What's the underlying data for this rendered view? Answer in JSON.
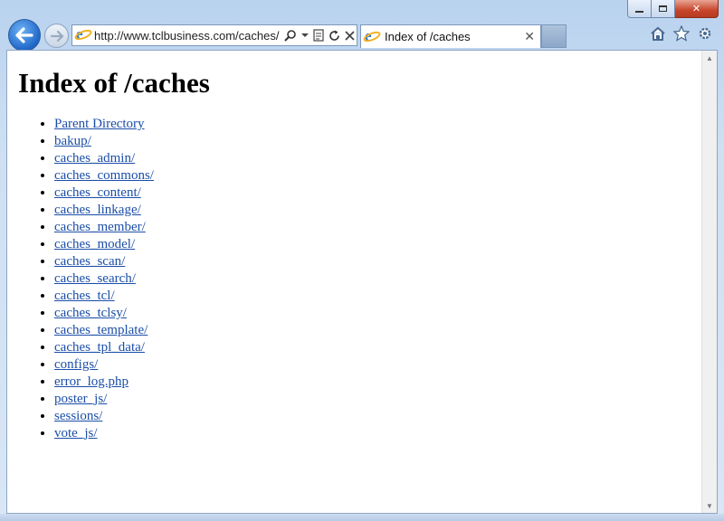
{
  "browser": {
    "address_url": "http://www.tclbusiness.com/caches/",
    "tab_title": "Index of /caches",
    "tab_close_glyph": "✕",
    "icons": [
      "back-arrow-icon",
      "forward-arrow-icon",
      "ie-logo-icon",
      "search-icon",
      "dropdown-icon",
      "compat-view-icon",
      "refresh-icon",
      "stop-icon",
      "home-icon",
      "favorites-star-icon",
      "tools-gear-icon"
    ],
    "caption": {
      "close_glyph": "✕"
    }
  },
  "page": {
    "heading": "Index of /caches",
    "items": [
      "Parent Directory",
      "bakup/",
      "caches_admin/",
      "caches_commons/",
      "caches_content/",
      "caches_linkage/",
      "caches_member/",
      "caches_model/",
      "caches_scan/",
      "caches_search/",
      "caches_tcl/",
      "caches_tclsy/",
      "caches_template/",
      "caches_tpl_data/",
      "configs/",
      "error_log.php",
      "poster_js/",
      "sessions/",
      "vote_js/"
    ]
  },
  "colors": {
    "link": "#1b4ea8",
    "frame": "#cfe0f3",
    "close_button": "#c7452a"
  }
}
